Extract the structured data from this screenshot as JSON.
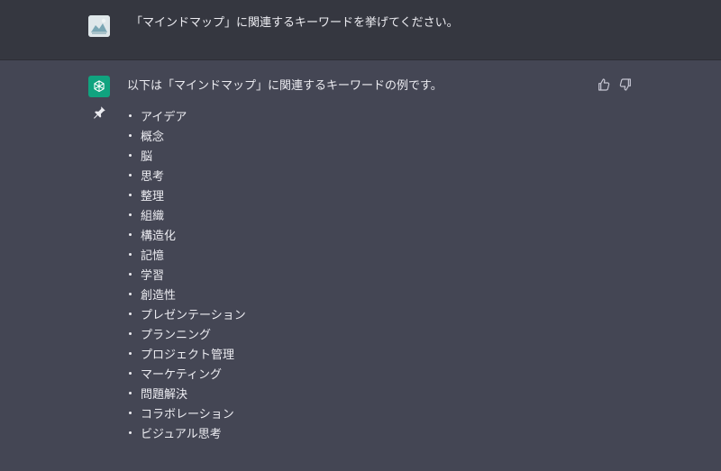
{
  "user_message": {
    "text": "「マインドマップ」に関連するキーワードを挙げてください。",
    "avatar_icon": "user-avatar-image"
  },
  "assistant_message": {
    "avatar_icon": "openai-logo-icon",
    "pin_icon": "pin-icon",
    "intro": "以下は「マインドマップ」に関連するキーワードの例です。",
    "keywords": [
      "アイデア",
      "概念",
      "脳",
      "思考",
      "整理",
      "組織",
      "構造化",
      "記憶",
      "学習",
      "創造性",
      "プレゼンテーション",
      "プランニング",
      "プロジェクト管理",
      "マーケティング",
      "問題解決",
      "コラボレーション",
      "ビジュアル思考"
    ],
    "feedback_icons": [
      "thumbs-up-icon",
      "thumbs-down-icon"
    ]
  },
  "colors": {
    "user_row_bg": "#353740",
    "assistant_row_bg": "#444654",
    "accent": "#10a37f",
    "text": "#ececf1"
  }
}
